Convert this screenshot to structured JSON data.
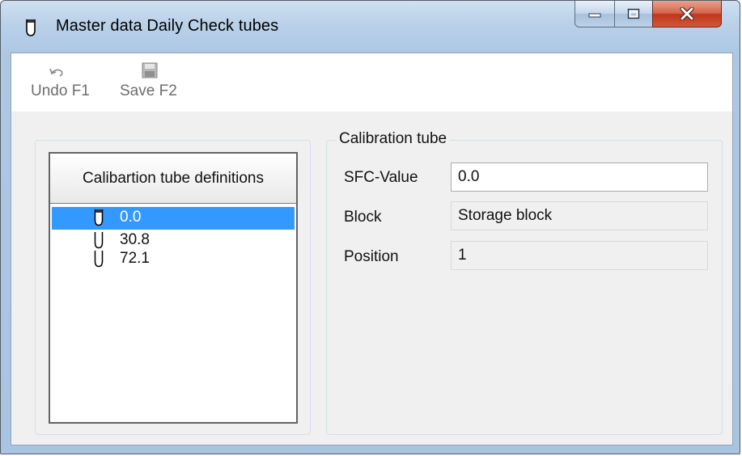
{
  "window": {
    "title": "Master data Daily Check tubes",
    "controls": {
      "minimize": "minimize",
      "maximize": "maximize",
      "close": "close"
    }
  },
  "toolbar": {
    "undo_label": "Undo F1",
    "save_label": "Save F2"
  },
  "list": {
    "header": "Calibartion tube definitions",
    "items": [
      {
        "value": "0.0",
        "selected": true
      },
      {
        "value": "30.8",
        "selected": false
      },
      {
        "value": "72.1",
        "selected": false
      }
    ]
  },
  "detail": {
    "group_title": "Calibration tube",
    "fields": [
      {
        "label": "SFC-Value",
        "value": "0.0",
        "editable": true
      },
      {
        "label": "Block",
        "value": "Storage block",
        "editable": false
      },
      {
        "label": "Position",
        "value": "1",
        "editable": false
      }
    ]
  },
  "colors": {
    "selection": "#3399ff",
    "close_button": "#c0361c",
    "frame": "#aec8e4"
  },
  "icons": [
    "tube-icon",
    "undo-icon",
    "save-icon",
    "minimize-icon",
    "maximize-icon",
    "close-icon"
  ]
}
